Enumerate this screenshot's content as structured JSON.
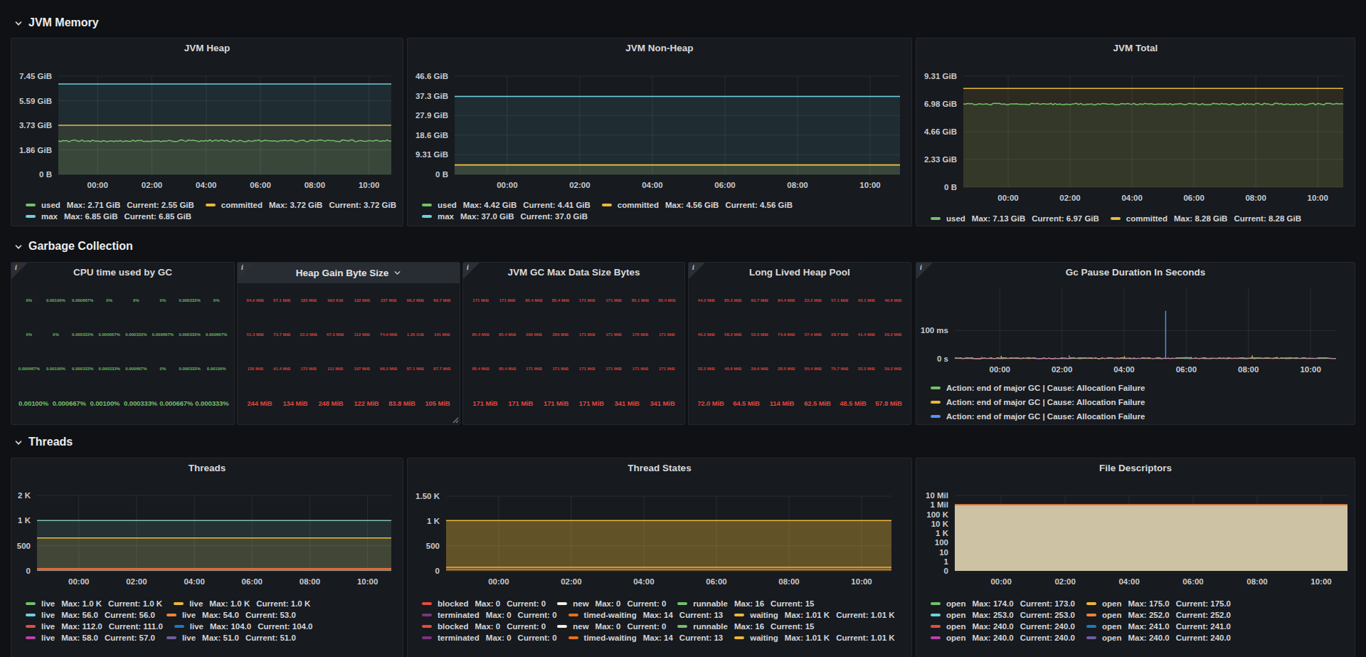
{
  "page": {
    "background": "#0f1115",
    "panel_background": "#171a1f",
    "accent_green": "#73bf69",
    "accent_yellow": "#eab839",
    "accent_cyan": "#6ed0e0",
    "accent_red": "#e0453e"
  },
  "sections": [
    {
      "label": "JVM Memory"
    },
    {
      "label": "Garbage Collection"
    },
    {
      "label": "Threads"
    }
  ],
  "x_ticks": [
    "00:00",
    "02:00",
    "04:00",
    "06:00",
    "08:00",
    "10:00"
  ],
  "chart_data": [
    {
      "id": "jvm-heap",
      "type": "line",
      "title": "JVM Heap",
      "section": "JVM Memory",
      "xlabel": "time",
      "ylabel": "bytes",
      "x_ticks": [
        "00:00",
        "02:00",
        "04:00",
        "06:00",
        "08:00",
        "10:00"
      ],
      "y_ticks": [
        "7.45 GiB",
        "5.59 GiB",
        "3.73 GiB",
        "1.86 GiB",
        "0 B"
      ],
      "scale": "linear",
      "ymax": 7.45,
      "series": [
        {
          "name": "used",
          "color": "#73bf69",
          "value": 2.55,
          "noise": 0.07,
          "fill": 0.1,
          "max": "2.71 GiB",
          "current": "2.55 GiB"
        },
        {
          "name": "committed",
          "color": "#eab839",
          "value": 3.72,
          "noise": 0,
          "fill": 0.1,
          "max": "3.72 GiB",
          "current": "3.72 GiB"
        },
        {
          "name": "max",
          "color": "#6ed0e0",
          "value": 6.85,
          "noise": 0,
          "fill": 0.1,
          "max": "6.85 GiB",
          "current": "6.85 GiB"
        }
      ],
      "legend_rows": [
        [
          {
            "color": "#73bf69",
            "name": "used",
            "max": "2.71 GiB",
            "current": "2.55 GiB"
          },
          {
            "color": "#eab839",
            "name": "committed",
            "max": "3.72 GiB",
            "current": "3.72 GiB"
          }
        ],
        [
          {
            "color": "#6ed0e0",
            "name": "max",
            "max": "6.85 GiB",
            "current": "6.85 GiB"
          }
        ]
      ]
    },
    {
      "id": "jvm-non-heap",
      "type": "line",
      "title": "JVM Non-Heap",
      "section": "JVM Memory",
      "x_ticks": [
        "00:00",
        "02:00",
        "04:00",
        "06:00",
        "08:00",
        "10:00"
      ],
      "y_ticks": [
        "46.6 GiB",
        "37.3 GiB",
        "27.9 GiB",
        "18.6 GiB",
        "9.31 GiB",
        "0 B"
      ],
      "scale": "linear",
      "ymax": 46.6,
      "series": [
        {
          "name": "used",
          "color": "#73bf69",
          "value": 4.41,
          "noise": 0.02,
          "fill": 0.1,
          "max": "4.42 GiB",
          "current": "4.41 GiB"
        },
        {
          "name": "committed",
          "color": "#eab839",
          "value": 4.56,
          "noise": 0,
          "fill": 0.1,
          "max": "4.56 GiB",
          "current": "4.56 GiB"
        },
        {
          "name": "max",
          "color": "#6ed0e0",
          "value": 37.0,
          "noise": 0,
          "fill": 0.1,
          "max": "37.0 GiB",
          "current": "37.0 GiB"
        }
      ],
      "legend_rows": [
        [
          {
            "color": "#73bf69",
            "name": "used",
            "max": "4.42 GiB",
            "current": "4.41 GiB"
          },
          {
            "color": "#eab839",
            "name": "committed",
            "max": "4.56 GiB",
            "current": "4.56 GiB"
          }
        ],
        [
          {
            "color": "#6ed0e0",
            "name": "max",
            "max": "37.0 GiB",
            "current": "37.0 GiB"
          }
        ]
      ]
    },
    {
      "id": "jvm-total",
      "type": "line",
      "title": "JVM Total",
      "section": "JVM Memory",
      "x_ticks": [
        "00:00",
        "02:00",
        "04:00",
        "06:00",
        "08:00",
        "10:00"
      ],
      "y_ticks": [
        "9.31 GiB",
        "6.98 GiB",
        "4.66 GiB",
        "2.33 GiB",
        "0 B"
      ],
      "scale": "linear",
      "ymax": 9.31,
      "series": [
        {
          "name": "used",
          "color": "#73bf69",
          "value": 6.97,
          "noise": 0.07,
          "fill": 0.1,
          "max": "7.13 GiB",
          "current": "6.97 GiB"
        },
        {
          "name": "committed",
          "color": "#eab839",
          "value": 8.28,
          "noise": 0,
          "fill": 0.1,
          "max": "8.28 GiB",
          "current": "8.28 GiB"
        }
      ],
      "legend_rows": [
        [
          {
            "color": "#73bf69",
            "name": "used",
            "max": "7.13 GiB",
            "current": "6.97 GiB"
          },
          {
            "color": "#eab839",
            "name": "committed",
            "max": "8.28 GiB",
            "current": "8.28 GiB"
          }
        ]
      ]
    },
    {
      "id": "cpu-gc",
      "type": "stat",
      "title": "CPU time used by GC",
      "section": "Garbage Collection",
      "value_color": "#73bf69",
      "info_icon": true,
      "small_rows": [
        [
          "0%",
          "0.00100%",
          "0.000667%",
          "0%",
          "0%",
          "0%",
          "0.000333%",
          "0%"
        ],
        [
          "0%",
          "0%",
          "0.000333%",
          "0.000667%",
          "0.000333%",
          "0.000667%",
          "0.000333%",
          "0.000667%"
        ],
        [
          "0.000667%",
          "0.00100%",
          "0.000333%",
          "0.000333%",
          "0.000667%",
          "0%",
          "0.000333%",
          "0.00100%"
        ]
      ],
      "large_row": [
        "0.00100%",
        "0.000667%",
        "0.00100%",
        "0.000333%",
        "0.000667%",
        "0.000333%"
      ]
    },
    {
      "id": "heap-gain",
      "type": "stat",
      "title": "Heap Gain Byte Size",
      "section": "Garbage Collection",
      "value_color": "#e0453e",
      "info_icon": true,
      "hover_header": true,
      "title_chevron": true,
      "resize_handle": true,
      "small_rows": [
        [
          "84.0 MiB",
          "67.1 MiB",
          "183 MiB",
          "992 KiB",
          "132 MiB",
          "237 MiB",
          "98.2 MiB",
          "69.7 MiB"
        ],
        [
          "51.3 MiB",
          "73.7 MiB",
          "22.2 MiB",
          "67.3 MiB",
          "112 MiB",
          "74.6 MiB",
          "1.20 GiB",
          "141 MiB"
        ],
        [
          "130 MiB",
          "91.4 MiB",
          "172 MiB",
          "111 MiB",
          "197 MiB",
          "96.2 MiB",
          "87.1 MiB",
          "87.7 MiB"
        ]
      ],
      "large_row": [
        "244 MiB",
        "134 MiB",
        "248 MiB",
        "122 MiB",
        "83.8 MiB",
        "105 MiB"
      ]
    },
    {
      "id": "gc-max",
      "type": "stat",
      "title": "JVM GC Max Data Size Bytes",
      "section": "Garbage Collection",
      "value_color": "#e0453e",
      "info_icon": true,
      "small_rows": [
        [
          "171 MiB",
          "171 MiB",
          "85.4 MiB",
          "85.4 MiB",
          "171 MiB",
          "171 MiB",
          "85.1 MiB",
          "85.4 MiB"
        ],
        [
          "85.4 MiB",
          "85.4 MiB",
          "200 MiB",
          "200 MiB",
          "171 MiB",
          "171 MiB",
          "170 MiB",
          "171 MiB"
        ],
        [
          "85.4 MiB",
          "85.4 MiB",
          "171 MiB",
          "171 MiB",
          "171 MiB",
          "171 MiB",
          "171 MiB",
          "171 MiB"
        ]
      ],
      "large_row": [
        "171 MiB",
        "171 MiB",
        "171 MiB",
        "171 MiB",
        "341 MiB",
        "341 MiB"
      ]
    },
    {
      "id": "long-lived",
      "type": "stat",
      "title": "Long Lived Heap Pool",
      "section": "Garbage Collection",
      "value_color": "#e0453e",
      "info_icon": true,
      "small_rows": [
        [
          "44.2 MiB",
          "85.3 MiB",
          "62.7 MiB",
          "84.4 MiB",
          "22.2 MiB",
          "57.1 MiB",
          "45.1 MiB",
          "40.6 MiB"
        ],
        [
          "45.2 MiB",
          "58.2 MiB",
          "52.5 MiB",
          "74.9 MiB",
          "57.4 MiB",
          "28.7 MiB",
          "41.4 MiB",
          "29.2 MiB"
        ],
        [
          "32.2 MiB",
          "40.6 MiB",
          "29.6 MiB",
          "28.5 MiB",
          "55.4 MiB",
          "75.7 MiB",
          "32.2 MiB",
          "29.2 MiB"
        ]
      ],
      "large_row": [
        "72.0 MiB",
        "64.5 MiB",
        "114 MiB",
        "62.5 MiB",
        "48.5 MiB",
        "57.8 MiB"
      ]
    },
    {
      "id": "gc-pause",
      "type": "line",
      "title": "Gc Pause Duration In Seconds",
      "section": "Garbage Collection",
      "info_icon": true,
      "x_ticks": [
        "00:00",
        "02:00",
        "04:00",
        "06:00",
        "08:00",
        "10:00"
      ],
      "y_ticks": [
        "100 ms",
        "0 s"
      ],
      "y_tick_values": [
        0.1,
        0
      ],
      "scale": "linear",
      "ymax": 0.25,
      "series": [
        {
          "name": "Action: end of major GC | Cause: Allocation Failure",
          "color": "#5794f2",
          "value": 0.001,
          "noise": 0.001,
          "fill": 0,
          "lw": 1,
          "spikes": [
            {
              "x": 0.3,
              "v": 0.012
            },
            {
              "x": 0.553,
              "v": 0.17
            }
          ]
        },
        {
          "name": "Action: end of major GC | Cause: Allocation Failure",
          "color": "#73bf69",
          "value": 0.0015,
          "noise": 0.001,
          "fill": 0,
          "lw": 1,
          "spikes": [
            {
              "x": 0.07,
              "v": 0.006
            },
            {
              "x": 0.62,
              "v": 0.007
            }
          ]
        },
        {
          "name": "Action: end of major GC | Cause: Allocation Failure",
          "color": "#eab839",
          "value": 0.002,
          "noise": 0.0015,
          "fill": 0,
          "lw": 1,
          "spikes": [
            {
              "x": 0.122,
              "v": 0.01
            },
            {
              "x": 0.445,
              "v": 0.009
            },
            {
              "x": 0.78,
              "v": 0.012
            },
            {
              "x": 0.845,
              "v": 0.007
            }
          ]
        },
        {
          "name": "Action: end of major GC | Cause: Allocation Failure",
          "color": "#c77ab8",
          "value": 0.0025,
          "noise": 0.002,
          "fill": 0,
          "lw": 1
        }
      ],
      "legend_rows": [
        [
          {
            "color": "#73bf69",
            "name": "Action: end of major GC | Cause: Allocation Failure"
          }
        ],
        [
          {
            "color": "#eab839",
            "name": "Action: end of major GC | Cause: Allocation Failure"
          }
        ],
        [
          {
            "color": "#5794f2",
            "name": "Action: end of major GC | Cause: Allocation Failure"
          }
        ]
      ]
    },
    {
      "id": "threads",
      "type": "line",
      "title": "Threads",
      "section": "Threads",
      "x_ticks": [
        "00:00",
        "02:00",
        "04:00",
        "06:00",
        "08:00",
        "10:00"
      ],
      "y_ticks": [
        "2 K",
        "1 K",
        "500",
        "0"
      ],
      "scale": "log2",
      "ymax": 2000,
      "series": [
        {
          "name": "live",
          "color": "#eab839",
          "value": 620,
          "noise": 0,
          "fill": 0.16,
          "plotted": "1.0 K drawn at visual position"
        },
        {
          "name": "live",
          "color": "#7fc2a8",
          "value": 1000,
          "noise": 0,
          "fill": 0.14
        }
      ],
      "bottom_lines": [
        {
          "color": "#ef843c",
          "dy": 3.5,
          "lw": 1.2
        },
        {
          "color": "#e24d42",
          "dy": 2.2,
          "lw": 1.2
        },
        {
          "color": "#e7c9c0",
          "dy": 1,
          "lw": 1
        }
      ],
      "legend_rows": [
        [
          {
            "color": "#73bf69",
            "name": "live",
            "max": "1.0 K",
            "current": "1.0 K"
          },
          {
            "color": "#eab839",
            "name": "live",
            "max": "1.0 K",
            "current": "1.0 K"
          }
        ],
        [
          {
            "color": "#6ed0e0",
            "name": "live",
            "max": "56.0",
            "current": "56.0"
          },
          {
            "color": "#ef843c",
            "name": "live",
            "max": "54.0",
            "current": "53.0"
          }
        ],
        [
          {
            "color": "#e24d42",
            "name": "live",
            "max": "112.0",
            "current": "111.0"
          },
          {
            "color": "#1f78c1",
            "name": "live",
            "max": "104.0",
            "current": "104.0"
          }
        ],
        [
          {
            "color": "#ba43a9",
            "name": "live",
            "max": "58.0",
            "current": "57.0"
          },
          {
            "color": "#705da0",
            "name": "live",
            "max": "51.0",
            "current": "51.0"
          }
        ]
      ]
    },
    {
      "id": "thread-states",
      "type": "line",
      "title": "Thread States",
      "section": "Threads",
      "x_ticks": [
        "00:00",
        "02:00",
        "04:00",
        "06:00",
        "08:00",
        "10:00"
      ],
      "y_ticks": [
        "1.50 K",
        "1 K",
        "500",
        "0"
      ],
      "scale": "linear",
      "ymax": 1500,
      "series": [
        {
          "name": "waiting",
          "color": "#eab839",
          "value": 1010,
          "noise": 0,
          "fill": 0.36,
          "max": "1.01 K",
          "current": "1.01 K"
        }
      ],
      "bottom_lines": [
        {
          "color": "#eab839",
          "dy": 5,
          "lw": 1.5
        },
        {
          "color": "#e8701a",
          "dy": 2,
          "lw": 1.5
        }
      ],
      "legend_rows": [
        [
          {
            "color": "#e24d42",
            "name": "blocked",
            "max": "0",
            "current": "0"
          },
          {
            "color": "#f7f0e4",
            "name": "new",
            "max": "0",
            "current": "0"
          },
          {
            "color": "#73bf69",
            "name": "runnable",
            "max": "16",
            "current": "15"
          }
        ],
        [
          {
            "color": "#7b3580",
            "name": "terminated",
            "max": "0",
            "current": "0"
          },
          {
            "color": "#e8701a",
            "name": "timed-waiting",
            "max": "14",
            "current": "13"
          },
          {
            "color": "#eab839",
            "name": "waiting",
            "max": "1.01 K",
            "current": "1.01 K"
          }
        ],
        [
          {
            "color": "#e24d42",
            "name": "blocked",
            "max": "0",
            "current": "0"
          },
          {
            "color": "#f7f0e4",
            "name": "new",
            "max": "0",
            "current": "0"
          },
          {
            "color": "#73bf69",
            "name": "runnable",
            "max": "16",
            "current": "15"
          }
        ],
        [
          {
            "color": "#7b3580",
            "name": "terminated",
            "max": "0",
            "current": "0"
          },
          {
            "color": "#e8701a",
            "name": "timed-waiting",
            "max": "14",
            "current": "13"
          },
          {
            "color": "#eab839",
            "name": "waiting",
            "max": "1.01 K",
            "current": "1.01 K"
          }
        ]
      ]
    },
    {
      "id": "file-descriptors",
      "type": "line",
      "title": "File Descriptors",
      "section": "Threads",
      "x_ticks": [
        "00:00",
        "02:00",
        "04:00",
        "06:00",
        "08:00",
        "10:00"
      ],
      "y_ticks": [
        "10 Mil",
        "1 Mil",
        "100 K",
        "10 K",
        "1 K",
        "100",
        "10",
        "1",
        "0"
      ],
      "scale": "log10",
      "ymax": 10000000,
      "series": [
        {
          "name": "limit",
          "color": "#ef843c",
          "value": 1000000,
          "noise": 0,
          "fill": 0,
          "lw": 2,
          "fill_solid": "#cdc2a4"
        }
      ],
      "legend_rows": [
        [
          {
            "color": "#73bf69",
            "name": "open",
            "max": "174.0",
            "current": "173.0"
          },
          {
            "color": "#eab839",
            "name": "open",
            "max": "175.0",
            "current": "175.0"
          }
        ],
        [
          {
            "color": "#6ed0e0",
            "name": "open",
            "max": "253.0",
            "current": "253.0"
          },
          {
            "color": "#ef843c",
            "name": "open",
            "max": "252.0",
            "current": "252.0"
          }
        ],
        [
          {
            "color": "#e24d42",
            "name": "open",
            "max": "240.0",
            "current": "240.0"
          },
          {
            "color": "#1f78c1",
            "name": "open",
            "max": "241.0",
            "current": "241.0"
          }
        ],
        [
          {
            "color": "#ba43a9",
            "name": "open",
            "max": "240.0",
            "current": "240.0"
          },
          {
            "color": "#705da0",
            "name": "open",
            "max": "240.0",
            "current": "240.0"
          }
        ]
      ]
    }
  ]
}
